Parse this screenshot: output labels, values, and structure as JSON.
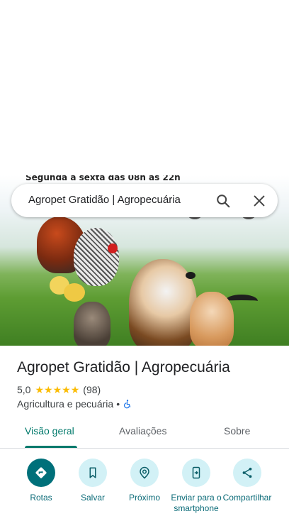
{
  "hero": {
    "caption": "Segunda a sexta das 08h as 22h"
  },
  "search": {
    "query": "Agropet Gratidão | Agropecuária"
  },
  "place": {
    "title": "Agropet Gratidão | Agropecuária",
    "rating": "5,0",
    "stars": 5,
    "review_count": "(98)",
    "category": "Agricultura e pecuária",
    "separator": "•"
  },
  "tabs": [
    {
      "label": "Visão geral",
      "active": true
    },
    {
      "label": "Avaliações",
      "active": false
    },
    {
      "label": "Sobre",
      "active": false
    }
  ],
  "actions": [
    {
      "label": "Rotas",
      "icon": "directions-icon"
    },
    {
      "label": "Salvar",
      "icon": "bookmark-icon"
    },
    {
      "label": "Próximo",
      "icon": "nearby-icon"
    },
    {
      "label": "Enviar para o smartphone",
      "icon": "send-to-phone-icon"
    },
    {
      "label": "Compartilhar",
      "icon": "share-icon"
    }
  ],
  "colors": {
    "accent": "#00796b",
    "primary_button": "#00707a",
    "button_bg": "#d2f1f6",
    "star": "#fbbc04"
  }
}
